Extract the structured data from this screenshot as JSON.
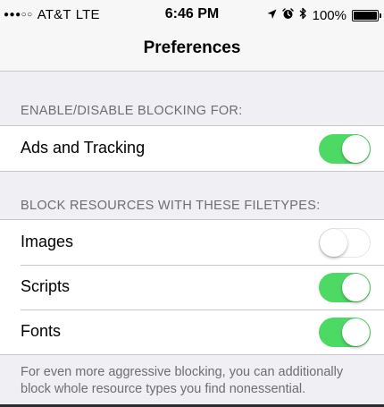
{
  "status_bar": {
    "signal": "●●●○○",
    "carrier": "AT&T",
    "network": "LTE",
    "time": "6:46 PM",
    "location_icon": "location-arrow-icon",
    "alarm_icon": "alarm-clock-icon",
    "bluetooth_icon": "bluetooth-icon",
    "battery_percent": "100%",
    "battery_level": 1.0
  },
  "nav": {
    "title": "Preferences"
  },
  "sections": {
    "blocking": {
      "header": "ENABLE/DISABLE BLOCKING FOR:",
      "items": [
        {
          "label": "Ads and Tracking",
          "enabled": true
        }
      ]
    },
    "filetypes": {
      "header": "BLOCK RESOURCES WITH THESE FILETYPES:",
      "items": [
        {
          "label": "Images",
          "enabled": false
        },
        {
          "label": "Scripts",
          "enabled": true
        },
        {
          "label": "Fonts",
          "enabled": true
        }
      ],
      "footer": "For even more aggressive blocking, you can additionally block whole resource types you find nonessential."
    }
  },
  "colors": {
    "toggle_on": "#4cd964",
    "background": "#efeff4",
    "section_text": "#6d6d72"
  }
}
